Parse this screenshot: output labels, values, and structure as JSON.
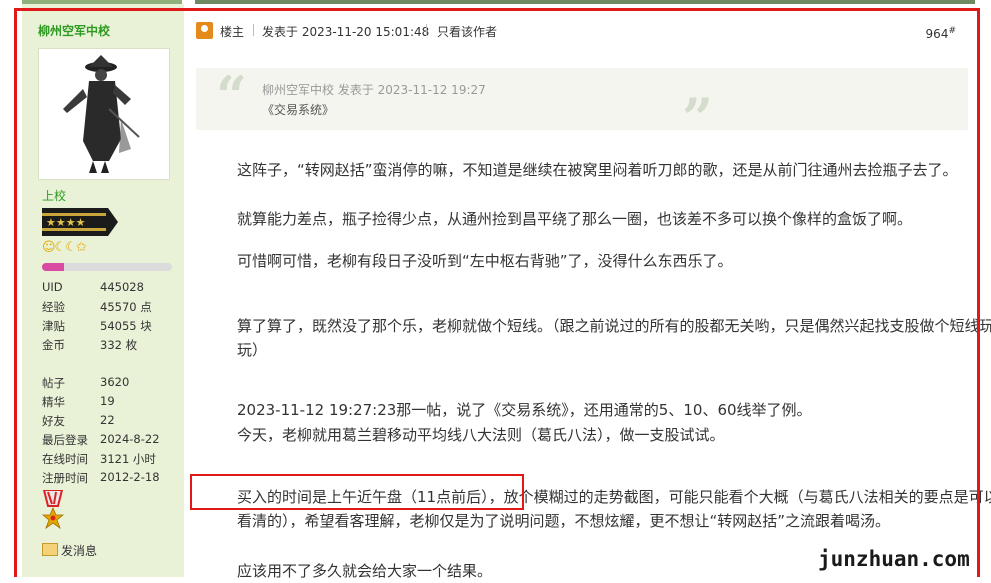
{
  "user": {
    "name": "柳州空军中校",
    "rank": "上校",
    "level_progress": 0.17,
    "stats": [
      {
        "k": "UID",
        "v": "445028"
      },
      {
        "k": "经验",
        "v": "45570 点"
      },
      {
        "k": "津贴",
        "v": "54055 块"
      },
      {
        "k": "金币",
        "v": "332 枚"
      },
      {
        "k": "帖子",
        "v": "3620"
      },
      {
        "k": "精华",
        "v": "19"
      },
      {
        "k": "好友",
        "v": "22"
      },
      {
        "k": "最后登录",
        "v": "2024-8-22"
      },
      {
        "k": "在线时间",
        "v": "3121 小时"
      },
      {
        "k": "注册时间",
        "v": "2012-2-18"
      }
    ],
    "send_message": "发消息"
  },
  "post_header": {
    "role": "楼主",
    "posted": "发表于 2023-11-20 15:01:48",
    "only_author": "只看该作者",
    "floor": "964",
    "floor_sup": "#"
  },
  "quote": {
    "meta": "柳州空军中校 发表于 2023-11-12 19:27",
    "text": "《交易系统》"
  },
  "paragraphs": [
    "这阵子，“转网赵括”蛮消停的嘛，不知道是继续在被窝里闷着听刀郎的歌，还是从前门往通州去捡瓶子去了。",
    "就算能力差点，瓶子捡得少点，从通州捡到昌平绕了那么一圈，也该差不多可以换个像样的盒饭了啊。",
    "可惜啊可惜，老柳有段日子没听到“左中枢右背驰”了，没得什么东西乐了。",
    "算了算了，既然没了那个乐，老柳就做个短线。（跟之前说过的所有的股都无关哟，只是偶然兴起找支股做个短线玩玩）",
    "2023-11-12 19:27:23那一帖，说了《交易系统》，还用通常的5、10、60线举了例。",
    "今天，老柳就用葛兰碧移动平均线八大法则（葛氏八法），做一支股试试。",
    "买入的时间是上午近午盘（11点前后），放个模糊过的走势截图，可能只能看个大概（与葛氏八法相关的要点是可以看清的），希望看客理解，老柳仅是为了说明问题，不想炫耀，更不想让“转网赵括”之流跟着喝汤。",
    "应该用不了多久就会给大家一个结果。"
  ],
  "watermark": "junzhuan.com",
  "colors": {
    "highlight_red": "#e01818",
    "sidebar_bg": "#e9f2d7",
    "username_green": "#2e9a22"
  }
}
